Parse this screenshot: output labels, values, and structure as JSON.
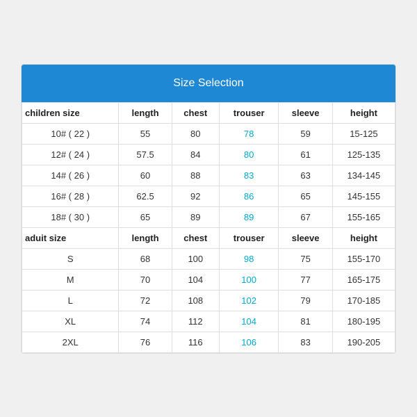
{
  "title": "Size Selection",
  "children_section": {
    "header": {
      "col1": "children size",
      "col2": "length",
      "col3": "chest",
      "col4": "trouser",
      "col5": "sleeve",
      "col6": "height"
    },
    "rows": [
      {
        "col1": "10# ( 22 )",
        "col2": "55",
        "col3": "80",
        "col4": "78",
        "col5": "59",
        "col6": "15-125"
      },
      {
        "col1": "12# ( 24 )",
        "col2": "57.5",
        "col3": "84",
        "col4": "80",
        "col5": "61",
        "col6": "125-135"
      },
      {
        "col1": "14# ( 26 )",
        "col2": "60",
        "col3": "88",
        "col4": "83",
        "col5": "63",
        "col6": "134-145"
      },
      {
        "col1": "16# ( 28 )",
        "col2": "62.5",
        "col3": "92",
        "col4": "86",
        "col5": "65",
        "col6": "145-155"
      },
      {
        "col1": "18# ( 30 )",
        "col2": "65",
        "col3": "89",
        "col4": "89",
        "col5": "67",
        "col6": "155-165"
      }
    ]
  },
  "adult_section": {
    "header": {
      "col1": "aduit size",
      "col2": "length",
      "col3": "chest",
      "col4": "trouser",
      "col5": "sleeve",
      "col6": "height"
    },
    "rows": [
      {
        "col1": "S",
        "col2": "68",
        "col3": "100",
        "col4": "98",
        "col5": "75",
        "col6": "155-170"
      },
      {
        "col1": "M",
        "col2": "70",
        "col3": "104",
        "col4": "100",
        "col5": "77",
        "col6": "165-175"
      },
      {
        "col1": "L",
        "col2": "72",
        "col3": "108",
        "col4": "102",
        "col5": "79",
        "col6": "170-185"
      },
      {
        "col1": "XL",
        "col2": "74",
        "col3": "112",
        "col4": "104",
        "col5": "81",
        "col6": "180-195"
      },
      {
        "col1": "2XL",
        "col2": "76",
        "col3": "116",
        "col4": "106",
        "col5": "83",
        "col6": "190-205"
      }
    ]
  }
}
